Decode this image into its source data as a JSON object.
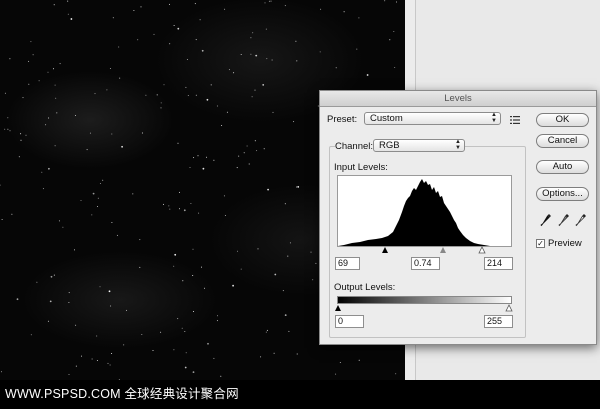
{
  "dialog": {
    "title": "Levels",
    "preset_label": "Preset:",
    "preset_value": "Custom",
    "channel_label": "Channel:",
    "channel_value": "RGB",
    "input_levels_label": "Input Levels:",
    "input_black": "69",
    "input_gamma": "0.74",
    "input_white": "214",
    "output_levels_label": "Output Levels:",
    "output_black": "0",
    "output_white": "255",
    "buttons": {
      "ok": "OK",
      "cancel": "Cancel",
      "auto": "Auto",
      "options": "Options..."
    },
    "preview_label": "Preview",
    "preview_checked": true
  },
  "watermark": "WWW.PSPSD.COM 全球经典设计聚合网",
  "icons": {
    "preset_menu": "list-menu-icon",
    "black_eyedropper": "eyedropper-black-icon",
    "gray_eyedropper": "eyedropper-gray-icon",
    "white_eyedropper": "eyedropper-white-icon"
  }
}
